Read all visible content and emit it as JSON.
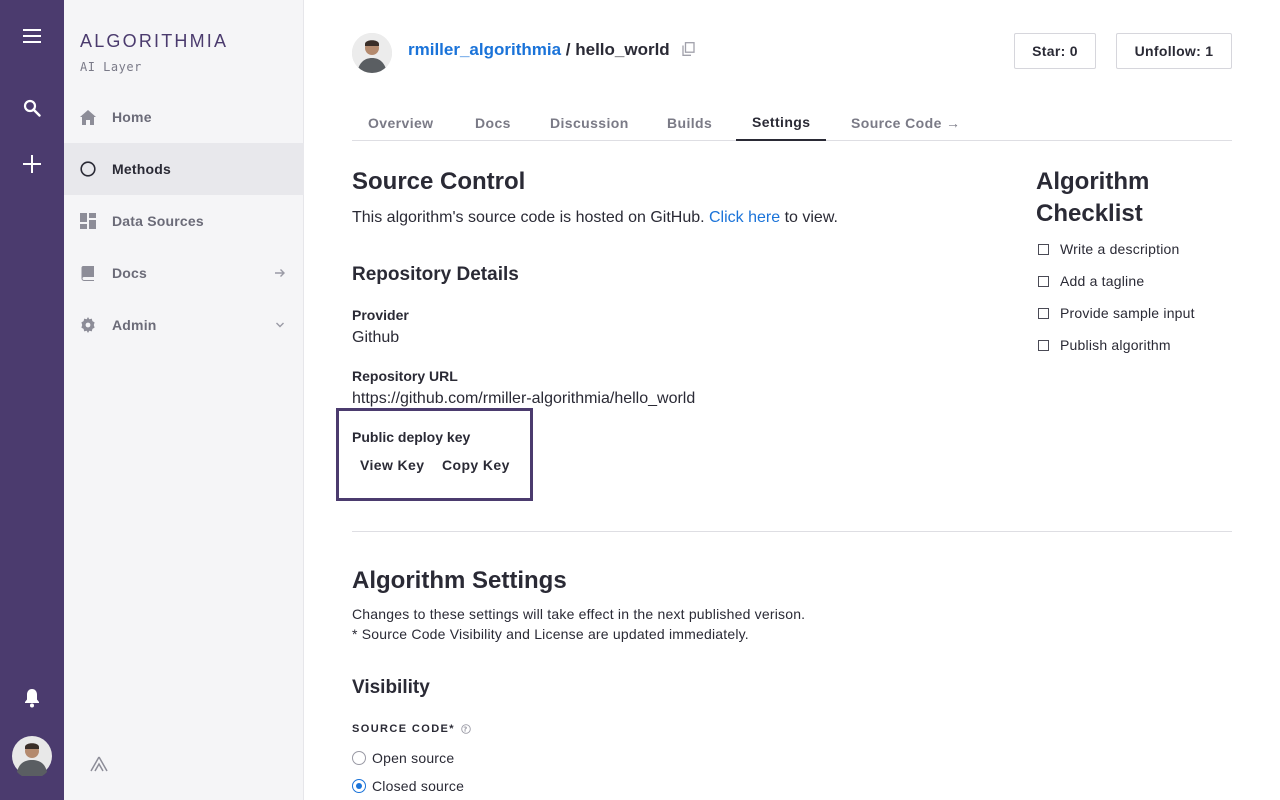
{
  "rail": {
    "icons": [
      "menu-icon",
      "search-icon",
      "plus-icon",
      "bell-icon",
      "user-avatar"
    ]
  },
  "sidebar": {
    "brand": "ALGORITHMIA",
    "tagline": "AI Layer",
    "items": [
      {
        "label": "Home",
        "icon": "home-icon"
      },
      {
        "label": "Methods",
        "icon": "circle-icon",
        "active": true
      },
      {
        "label": "Data Sources",
        "icon": "grid-icon"
      },
      {
        "label": "Docs",
        "icon": "book-icon",
        "trail": "arrow-right-icon"
      },
      {
        "label": "Admin",
        "icon": "gear-icon",
        "trail": "chevron-down-icon"
      }
    ]
  },
  "header": {
    "owner": "rmiller_algorithmia",
    "separator": " / ",
    "algo": "hello_world",
    "star_label": "Star: 0",
    "unfollow_label": "Unfollow: 1"
  },
  "tabs": [
    {
      "label": "Overview"
    },
    {
      "label": "Docs"
    },
    {
      "label": "Discussion"
    },
    {
      "label": "Builds"
    },
    {
      "label": "Settings",
      "active": true
    },
    {
      "label": "Source Code →"
    }
  ],
  "source_control": {
    "title": "Source Control",
    "text_before": "This algorithm's source code is hosted on GitHub. ",
    "link": "Click here",
    "text_after": " to view."
  },
  "repo": {
    "title": "Repository Details",
    "provider_label": "Provider",
    "provider_value": "Github",
    "url_label": "Repository URL",
    "url_value": "https://github.com/rmiller-algorithmia/hello_world",
    "deploy_label": "Public deploy key",
    "view_key": "View Key",
    "copy_key": "Copy Key"
  },
  "algo_settings": {
    "title": "Algorithm Settings",
    "line1": "Changes to these settings will take effect in the next published verison.",
    "line2": "* Source Code Visibility and License are updated immediately.",
    "visibility_title": "Visibility",
    "source_code_label": "SOURCE CODE*",
    "options": [
      {
        "label": "Open source",
        "checked": false
      },
      {
        "label": "Closed source",
        "checked": true
      }
    ]
  },
  "checklist": {
    "title": "Algorithm Checklist",
    "items": [
      "Write a description",
      "Add a tagline",
      "Provide sample input",
      "Publish algorithm"
    ]
  },
  "colors": {
    "rail": "#4b3b6e",
    "link": "#1a73d9",
    "highlight_box": "#4b3b6e"
  }
}
